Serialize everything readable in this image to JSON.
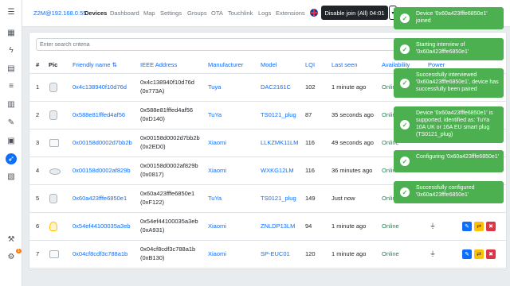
{
  "nav": {
    "brand": "Z2M@192.168.0.55",
    "items": [
      "Devices",
      "Dashboard",
      "Map",
      "Settings",
      "Groups",
      "OTA",
      "Touchlink",
      "Logs",
      "Extensions"
    ],
    "join_button": "Disable join (All) 04:01",
    "join_caret": "▾"
  },
  "sidebar": {
    "icons": [
      "menu-icon",
      "dashboard-icon",
      "lightning-icon",
      "id-card-icon",
      "list-icon",
      "chart-icon",
      "wrench-icon",
      "network-icon",
      "compass-icon",
      "image-icon",
      "hammer-icon",
      "settings-icon"
    ],
    "badge": "1"
  },
  "search": {
    "placeholder": "Enter search criteria",
    "value": ""
  },
  "table": {
    "headers": {
      "num": "#",
      "pic": "Pic",
      "name": "Friendly name ⇅",
      "ieee": "IEEE Address",
      "manufacturer": "Manufacturer",
      "model": "Model",
      "lqi": "LQI",
      "last_seen": "Last seen",
      "availability": "Availability",
      "power": "Power"
    },
    "rows": [
      {
        "num": "1",
        "name": "0x4c138940f10d76d",
        "ieee": "0x4c138940f10d76d",
        "nwk": "(0x773A)",
        "manufacturer": "Tuya",
        "model": "DAC2161C",
        "lqi": "102",
        "last_seen": "1 minute ago",
        "availability": "Online"
      },
      {
        "num": "2",
        "name": "0x588e81fffed4af56",
        "ieee": "0x588e81fffed4af56",
        "nwk": "(0xD140)",
        "manufacturer": "TuYa",
        "model": "TS0121_plug",
        "lqi": "87",
        "last_seen": "35 seconds ago",
        "availability": "Online"
      },
      {
        "num": "3",
        "name": "0x00158d0002d7bb2b",
        "ieee": "0x00158d0002d7bb2b",
        "nwk": "(0x2ED0)",
        "manufacturer": "Xiaomi",
        "model": "LLKZMK11LM",
        "lqi": "116",
        "last_seen": "49 seconds ago",
        "availability": "Online"
      },
      {
        "num": "4",
        "name": "0x00158d0002af829b",
        "ieee": "0x00158d0002af829b",
        "nwk": "(0x0817)",
        "manufacturer": "Xiaomi",
        "model": "WXKG12LM",
        "lqi": "116",
        "last_seen": "36 minutes ago",
        "availability": "Online"
      },
      {
        "num": "5",
        "name": "0x60a423fffe6850e1",
        "ieee": "0x60a423fffe6850e1",
        "nwk": "(0xF122)",
        "manufacturer": "TuYa",
        "model": "TS0121_plug",
        "lqi": "149",
        "last_seen": "Just now",
        "availability": "Online"
      },
      {
        "num": "6",
        "name": "0x54ef44100035a3eb",
        "ieee": "0x54ef44100035a3eb",
        "nwk": "(0xA931)",
        "manufacturer": "Xiaomi",
        "model": "ZNLDP13LM",
        "lqi": "94",
        "last_seen": "1 minute ago",
        "availability": "Online"
      },
      {
        "num": "7",
        "name": "0x04cf8cdf3c788a1b",
        "ieee": "0x04cf8cdf3c788a1b",
        "nwk": "(0xB130)",
        "manufacturer": "Xiaomi",
        "model": "SP-EUC01",
        "lqi": "120",
        "last_seen": "1 minute ago",
        "availability": "Online"
      }
    ]
  },
  "toasts": [
    "Device '0x60a423fffe6850e1' joined",
    "Starting interview of '0x60a423fffe6850e1'",
    "Successfully interviewed '0x60a423fffe6850e1', device has successfully been paired",
    "Device '0x60a423fffe6850e1' is supported, identified as: TuYa 10A UK or 16A EU smart plug (TS0121_plug)",
    "Configuring '0x60a423fffe6850e1'",
    "Successfully configured '0x60a423fffe6850e1'"
  ],
  "colors": {
    "primary": "#0d6efd",
    "toast": "#4caf50",
    "online": "#198754"
  }
}
